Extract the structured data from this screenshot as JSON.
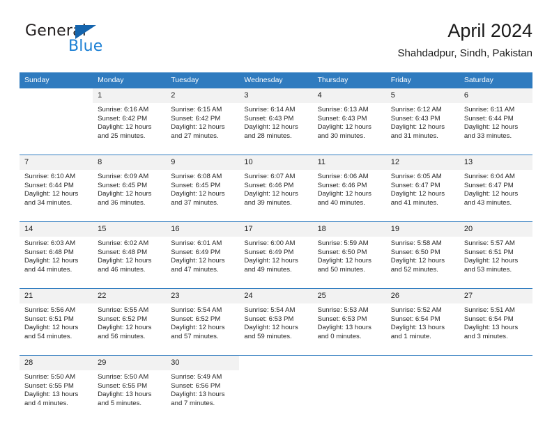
{
  "brand": {
    "name_part1": "General",
    "name_part2": "Blue",
    "triangle_icon": "blue-triangle-icon",
    "accent_color": "#1b7fd4",
    "dark_color": "#1464ad"
  },
  "header": {
    "title": "April 2024",
    "subtitle": "Shahdadpur, Sindh, Pakistan"
  },
  "theme": {
    "header_bg": "#2f7bbf",
    "daynum_bg": "#f2f2f2",
    "separator": "#2f7bbf"
  },
  "weekdays": [
    "Sunday",
    "Monday",
    "Tuesday",
    "Wednesday",
    "Thursday",
    "Friday",
    "Saturday"
  ],
  "weeks": [
    {
      "days": [
        {
          "num": "",
          "sunrise": "",
          "sunset": "",
          "daylight1": "",
          "daylight2": ""
        },
        {
          "num": "1",
          "sunrise": "Sunrise: 6:16 AM",
          "sunset": "Sunset: 6:42 PM",
          "daylight1": "Daylight: 12 hours",
          "daylight2": "and 25 minutes."
        },
        {
          "num": "2",
          "sunrise": "Sunrise: 6:15 AM",
          "sunset": "Sunset: 6:42 PM",
          "daylight1": "Daylight: 12 hours",
          "daylight2": "and 27 minutes."
        },
        {
          "num": "3",
          "sunrise": "Sunrise: 6:14 AM",
          "sunset": "Sunset: 6:43 PM",
          "daylight1": "Daylight: 12 hours",
          "daylight2": "and 28 minutes."
        },
        {
          "num": "4",
          "sunrise": "Sunrise: 6:13 AM",
          "sunset": "Sunset: 6:43 PM",
          "daylight1": "Daylight: 12 hours",
          "daylight2": "and 30 minutes."
        },
        {
          "num": "5",
          "sunrise": "Sunrise: 6:12 AM",
          "sunset": "Sunset: 6:43 PM",
          "daylight1": "Daylight: 12 hours",
          "daylight2": "and 31 minutes."
        },
        {
          "num": "6",
          "sunrise": "Sunrise: 6:11 AM",
          "sunset": "Sunset: 6:44 PM",
          "daylight1": "Daylight: 12 hours",
          "daylight2": "and 33 minutes."
        }
      ]
    },
    {
      "days": [
        {
          "num": "7",
          "sunrise": "Sunrise: 6:10 AM",
          "sunset": "Sunset: 6:44 PM",
          "daylight1": "Daylight: 12 hours",
          "daylight2": "and 34 minutes."
        },
        {
          "num": "8",
          "sunrise": "Sunrise: 6:09 AM",
          "sunset": "Sunset: 6:45 PM",
          "daylight1": "Daylight: 12 hours",
          "daylight2": "and 36 minutes."
        },
        {
          "num": "9",
          "sunrise": "Sunrise: 6:08 AM",
          "sunset": "Sunset: 6:45 PM",
          "daylight1": "Daylight: 12 hours",
          "daylight2": "and 37 minutes."
        },
        {
          "num": "10",
          "sunrise": "Sunrise: 6:07 AM",
          "sunset": "Sunset: 6:46 PM",
          "daylight1": "Daylight: 12 hours",
          "daylight2": "and 39 minutes."
        },
        {
          "num": "11",
          "sunrise": "Sunrise: 6:06 AM",
          "sunset": "Sunset: 6:46 PM",
          "daylight1": "Daylight: 12 hours",
          "daylight2": "and 40 minutes."
        },
        {
          "num": "12",
          "sunrise": "Sunrise: 6:05 AM",
          "sunset": "Sunset: 6:47 PM",
          "daylight1": "Daylight: 12 hours",
          "daylight2": "and 41 minutes."
        },
        {
          "num": "13",
          "sunrise": "Sunrise: 6:04 AM",
          "sunset": "Sunset: 6:47 PM",
          "daylight1": "Daylight: 12 hours",
          "daylight2": "and 43 minutes."
        }
      ]
    },
    {
      "days": [
        {
          "num": "14",
          "sunrise": "Sunrise: 6:03 AM",
          "sunset": "Sunset: 6:48 PM",
          "daylight1": "Daylight: 12 hours",
          "daylight2": "and 44 minutes."
        },
        {
          "num": "15",
          "sunrise": "Sunrise: 6:02 AM",
          "sunset": "Sunset: 6:48 PM",
          "daylight1": "Daylight: 12 hours",
          "daylight2": "and 46 minutes."
        },
        {
          "num": "16",
          "sunrise": "Sunrise: 6:01 AM",
          "sunset": "Sunset: 6:49 PM",
          "daylight1": "Daylight: 12 hours",
          "daylight2": "and 47 minutes."
        },
        {
          "num": "17",
          "sunrise": "Sunrise: 6:00 AM",
          "sunset": "Sunset: 6:49 PM",
          "daylight1": "Daylight: 12 hours",
          "daylight2": "and 49 minutes."
        },
        {
          "num": "18",
          "sunrise": "Sunrise: 5:59 AM",
          "sunset": "Sunset: 6:50 PM",
          "daylight1": "Daylight: 12 hours",
          "daylight2": "and 50 minutes."
        },
        {
          "num": "19",
          "sunrise": "Sunrise: 5:58 AM",
          "sunset": "Sunset: 6:50 PM",
          "daylight1": "Daylight: 12 hours",
          "daylight2": "and 52 minutes."
        },
        {
          "num": "20",
          "sunrise": "Sunrise: 5:57 AM",
          "sunset": "Sunset: 6:51 PM",
          "daylight1": "Daylight: 12 hours",
          "daylight2": "and 53 minutes."
        }
      ]
    },
    {
      "days": [
        {
          "num": "21",
          "sunrise": "Sunrise: 5:56 AM",
          "sunset": "Sunset: 6:51 PM",
          "daylight1": "Daylight: 12 hours",
          "daylight2": "and 54 minutes."
        },
        {
          "num": "22",
          "sunrise": "Sunrise: 5:55 AM",
          "sunset": "Sunset: 6:52 PM",
          "daylight1": "Daylight: 12 hours",
          "daylight2": "and 56 minutes."
        },
        {
          "num": "23",
          "sunrise": "Sunrise: 5:54 AM",
          "sunset": "Sunset: 6:52 PM",
          "daylight1": "Daylight: 12 hours",
          "daylight2": "and 57 minutes."
        },
        {
          "num": "24",
          "sunrise": "Sunrise: 5:54 AM",
          "sunset": "Sunset: 6:53 PM",
          "daylight1": "Daylight: 12 hours",
          "daylight2": "and 59 minutes."
        },
        {
          "num": "25",
          "sunrise": "Sunrise: 5:53 AM",
          "sunset": "Sunset: 6:53 PM",
          "daylight1": "Daylight: 13 hours",
          "daylight2": "and 0 minutes."
        },
        {
          "num": "26",
          "sunrise": "Sunrise: 5:52 AM",
          "sunset": "Sunset: 6:54 PM",
          "daylight1": "Daylight: 13 hours",
          "daylight2": "and 1 minute."
        },
        {
          "num": "27",
          "sunrise": "Sunrise: 5:51 AM",
          "sunset": "Sunset: 6:54 PM",
          "daylight1": "Daylight: 13 hours",
          "daylight2": "and 3 minutes."
        }
      ]
    },
    {
      "days": [
        {
          "num": "28",
          "sunrise": "Sunrise: 5:50 AM",
          "sunset": "Sunset: 6:55 PM",
          "daylight1": "Daylight: 13 hours",
          "daylight2": "and 4 minutes."
        },
        {
          "num": "29",
          "sunrise": "Sunrise: 5:50 AM",
          "sunset": "Sunset: 6:55 PM",
          "daylight1": "Daylight: 13 hours",
          "daylight2": "and 5 minutes."
        },
        {
          "num": "30",
          "sunrise": "Sunrise: 5:49 AM",
          "sunset": "Sunset: 6:56 PM",
          "daylight1": "Daylight: 13 hours",
          "daylight2": "and 7 minutes."
        },
        {
          "num": "",
          "sunrise": "",
          "sunset": "",
          "daylight1": "",
          "daylight2": ""
        },
        {
          "num": "",
          "sunrise": "",
          "sunset": "",
          "daylight1": "",
          "daylight2": ""
        },
        {
          "num": "",
          "sunrise": "",
          "sunset": "",
          "daylight1": "",
          "daylight2": ""
        },
        {
          "num": "",
          "sunrise": "",
          "sunset": "",
          "daylight1": "",
          "daylight2": ""
        }
      ]
    }
  ]
}
